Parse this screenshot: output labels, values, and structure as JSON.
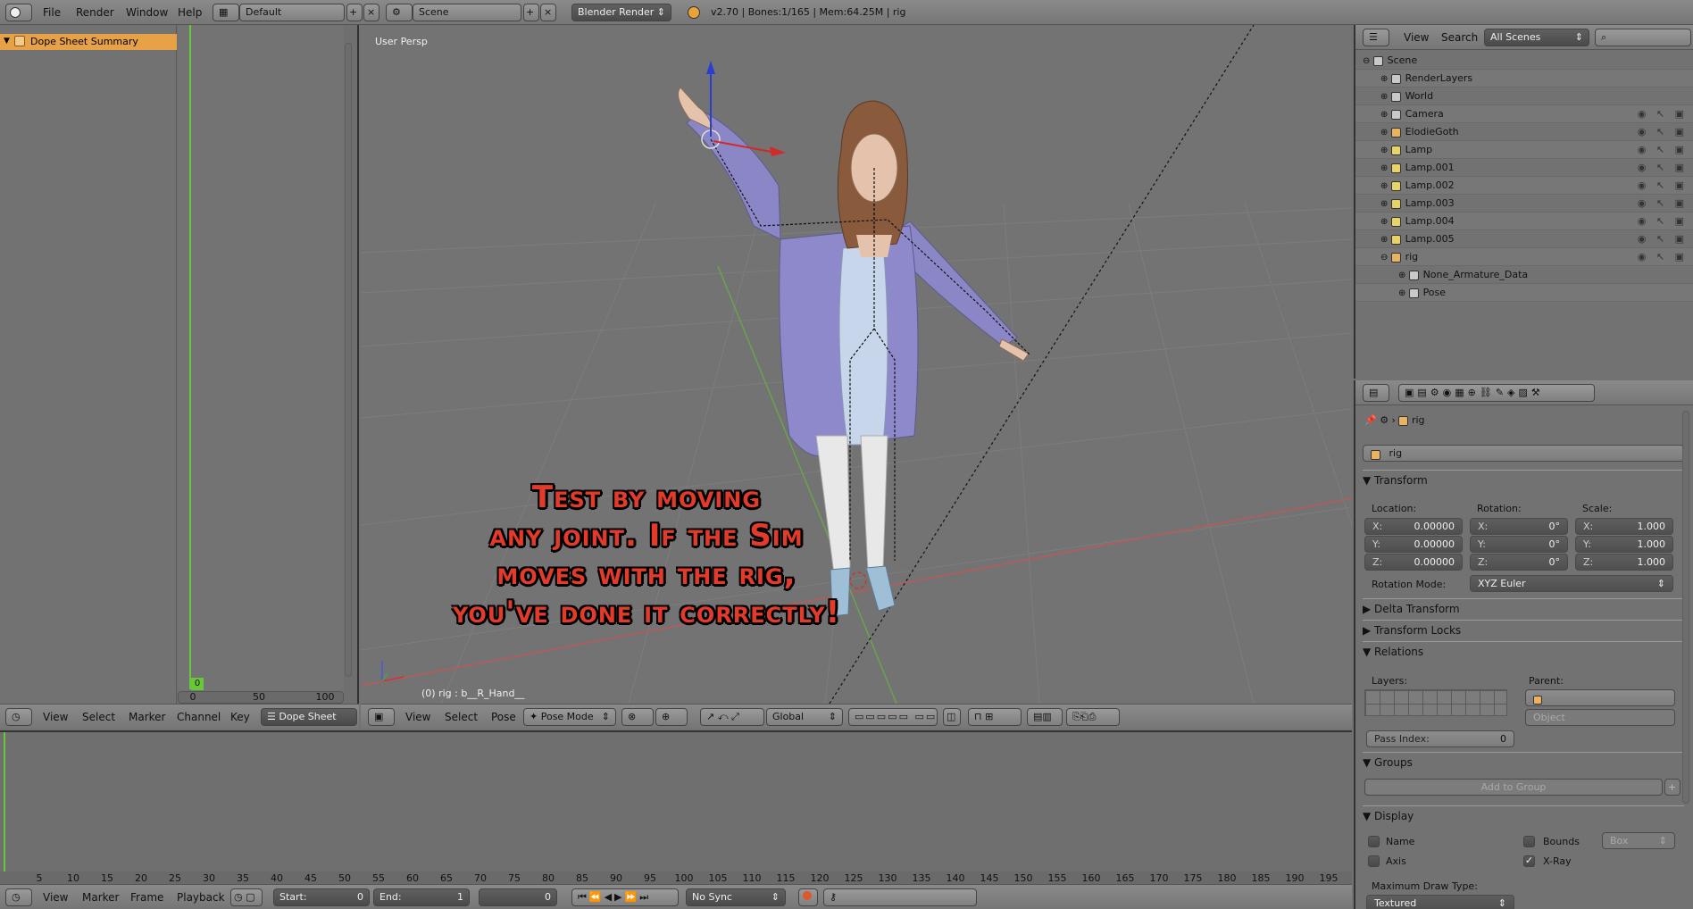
{
  "topbar": {
    "menus": [
      "File",
      "Render",
      "Window",
      "Help"
    ],
    "layout": "Default",
    "scene": "Scene",
    "engine": "Blender Render",
    "stats": "v2.70 | Bones:1/165 | Mem:64.25M | rig"
  },
  "dopesheet": {
    "summary": "Dope Sheet Summary",
    "current_frame": "0",
    "ruler": [
      "0",
      "50",
      "100"
    ],
    "footer": {
      "menus": [
        "View",
        "Select",
        "Marker",
        "Channel",
        "Key"
      ],
      "mode": "Dope Sheet"
    }
  },
  "viewport": {
    "label": "User Persp",
    "status": "(0) rig : b__R_Hand__",
    "caption": [
      "Test by moving",
      "any joint. If the Sim",
      "moves with the rig,",
      "you've done it correctly!"
    ],
    "footer": {
      "menus": [
        "View",
        "Select",
        "Pose"
      ],
      "mode": "Pose Mode",
      "orientation": "Global"
    }
  },
  "outliner": {
    "menus": [
      "View",
      "Search"
    ],
    "filter": "All Scenes",
    "items": [
      {
        "label": "Scene",
        "indent": 0
      },
      {
        "label": "RenderLayers",
        "indent": 1
      },
      {
        "label": "World",
        "indent": 1
      },
      {
        "label": "Camera",
        "indent": 1
      },
      {
        "label": "ElodieGoth",
        "indent": 1
      },
      {
        "label": "Lamp",
        "indent": 1
      },
      {
        "label": "Lamp.001",
        "indent": 1
      },
      {
        "label": "Lamp.002",
        "indent": 1
      },
      {
        "label": "Lamp.003",
        "indent": 1
      },
      {
        "label": "Lamp.004",
        "indent": 1
      },
      {
        "label": "Lamp.005",
        "indent": 1
      },
      {
        "label": "rig",
        "indent": 1
      },
      {
        "label": "None_Armature_Data",
        "indent": 2
      },
      {
        "label": "Pose",
        "indent": 2
      }
    ]
  },
  "properties": {
    "context": "rig",
    "name": "rig",
    "transform": {
      "title": "Transform",
      "location_label": "Location:",
      "rotation_label": "Rotation:",
      "scale_label": "Scale:",
      "location": [
        {
          "axis": "X:",
          "value": "0.00000"
        },
        {
          "axis": "Y:",
          "value": "0.00000"
        },
        {
          "axis": "Z:",
          "value": "0.00000"
        }
      ],
      "rotation": [
        {
          "axis": "X:",
          "value": "0°"
        },
        {
          "axis": "Y:",
          "value": "0°"
        },
        {
          "axis": "Z:",
          "value": "0°"
        }
      ],
      "scale": [
        {
          "axis": "X:",
          "value": "1.000"
        },
        {
          "axis": "Y:",
          "value": "1.000"
        },
        {
          "axis": "Z:",
          "value": "1.000"
        }
      ],
      "rotation_mode_label": "Rotation Mode:",
      "rotation_mode": "XYZ Euler"
    },
    "panels": {
      "delta": "Delta Transform",
      "locks": "Transform Locks",
      "relations": "Relations",
      "groups": "Groups",
      "display": "Display"
    },
    "relations": {
      "layers_label": "Layers:",
      "parent_label": "Parent:",
      "parent_type": "Object",
      "pass_index_label": "Pass Index:",
      "pass_index": "0"
    },
    "groups": {
      "add": "Add to Group"
    },
    "display": {
      "name": "Name",
      "axis": "Axis",
      "bounds": "Bounds",
      "bounds_type": "Box",
      "xray": "X-Ray",
      "max_draw_label": "Maximum Draw Type:",
      "max_draw": "Textured"
    }
  },
  "timeline": {
    "ticks": [
      "5",
      "10",
      "15",
      "20",
      "25",
      "30",
      "35",
      "40",
      "45",
      "50",
      "55",
      "60",
      "65",
      "70",
      "75",
      "80",
      "85",
      "90",
      "95",
      "100",
      "105",
      "110",
      "115",
      "120",
      "125",
      "130",
      "135",
      "140",
      "145",
      "150",
      "155",
      "160",
      "165",
      "170",
      "175",
      "180",
      "185",
      "190",
      "195"
    ],
    "footer": {
      "menus": [
        "View",
        "Marker",
        "Frame",
        "Playback"
      ],
      "start_label": "Start:",
      "start": "0",
      "end_label": "End:",
      "end": "1",
      "current": "0",
      "sync": "No Sync"
    }
  }
}
